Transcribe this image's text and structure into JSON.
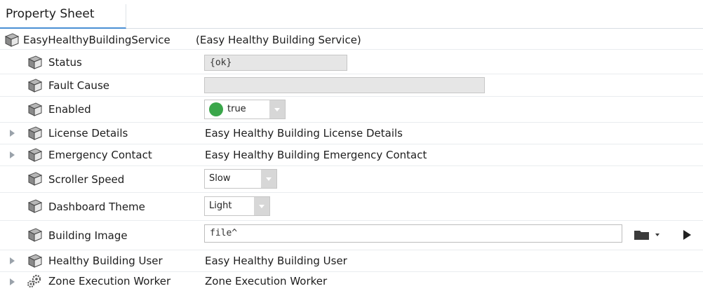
{
  "tab": {
    "label": "Property Sheet"
  },
  "root": {
    "name": "EasyHealthyBuildingService",
    "display": "(Easy Healthy Building Service)"
  },
  "properties": [
    {
      "label": "Status",
      "kind": "readonly",
      "value": "{ok}"
    },
    {
      "label": "Fault Cause",
      "kind": "readonly",
      "value": ""
    },
    {
      "label": "Enabled",
      "kind": "boolean-select",
      "value": "true",
      "status_color": "#3aa64a"
    },
    {
      "label": "License Details",
      "kind": "expandable",
      "value": "Easy Healthy Building License Details"
    },
    {
      "label": "Emergency Contact",
      "kind": "expandable",
      "value": "Easy Healthy Building Emergency Contact"
    },
    {
      "label": "Scroller Speed",
      "kind": "select",
      "value": "Slow"
    },
    {
      "label": "Dashboard Theme",
      "kind": "select",
      "value": "Light"
    },
    {
      "label": "Building Image",
      "kind": "file-field",
      "value": "file^"
    },
    {
      "label": "Healthy Building User",
      "kind": "expandable",
      "value": "Easy Healthy Building User"
    },
    {
      "label": "Zone Execution Worker",
      "kind": "expandable",
      "value": "Zone Execution Worker",
      "icon": "gears-icon"
    }
  ],
  "icons": {
    "component": "component-cube-icon",
    "worker": "gears-icon",
    "folder": "folder-icon",
    "play": "play-icon",
    "expand": "expand-arrow-icon"
  }
}
